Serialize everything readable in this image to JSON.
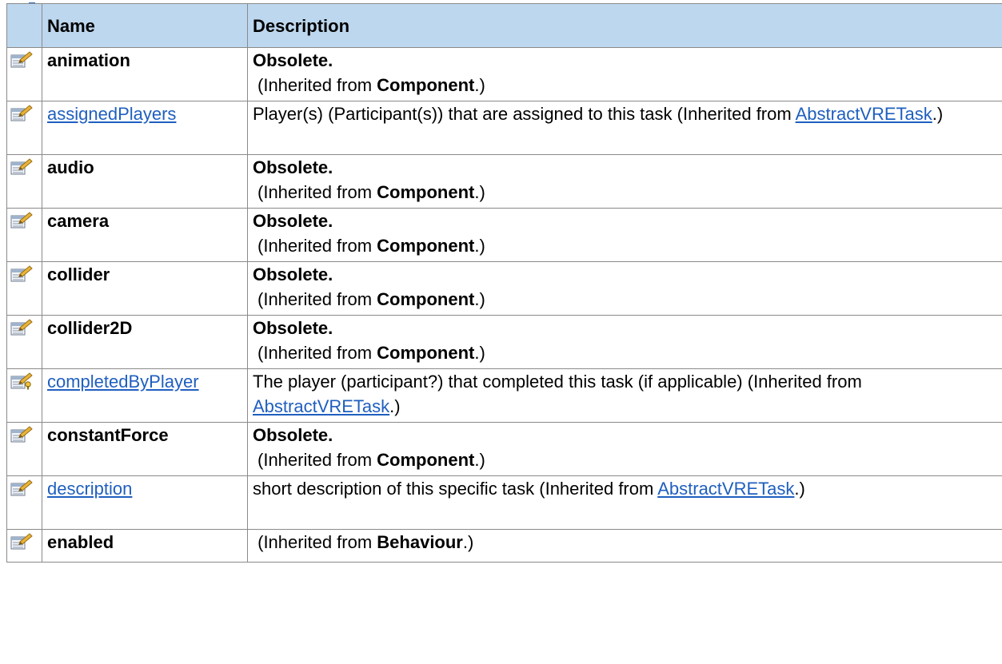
{
  "table": {
    "headers": {
      "name": "Name",
      "description": "Description"
    },
    "rows": [
      {
        "icon": "property-icon",
        "name": "animation",
        "name_type": "bold",
        "desc_main": "Obsolete.",
        "desc_prefix": "(Inherited from ",
        "desc_source": "Component",
        "desc_suffix": ".)"
      },
      {
        "icon": "property-icon",
        "name": "assignedPlayers",
        "name_type": "link",
        "desc_text": "Player(s) (Participant(s)) that are assigned to this task (Inherited from ",
        "desc_link": "AbstractVRETask",
        "desc_suffix": ".)"
      },
      {
        "icon": "property-icon",
        "name": "audio",
        "name_type": "bold",
        "desc_main": "Obsolete.",
        "desc_prefix": "(Inherited from ",
        "desc_source": "Component",
        "desc_suffix": ".)"
      },
      {
        "icon": "property-icon",
        "name": "camera",
        "name_type": "bold",
        "desc_main": "Obsolete.",
        "desc_prefix": "(Inherited from ",
        "desc_source": "Component",
        "desc_suffix": ".)"
      },
      {
        "icon": "property-icon",
        "name": "collider",
        "name_type": "bold",
        "desc_main": "Obsolete.",
        "desc_prefix": "(Inherited from ",
        "desc_source": "Component",
        "desc_suffix": ".)"
      },
      {
        "icon": "property-icon",
        "name": "collider2D",
        "name_type": "bold",
        "desc_main": "Obsolete.",
        "desc_prefix": "(Inherited from ",
        "desc_source": "Component",
        "desc_suffix": ".)"
      },
      {
        "icon": "property-key-icon",
        "name": "completedByPlayer",
        "name_type": "link",
        "desc_text": "The player (participant?) that completed this task (if applicable) (Inherited from ",
        "desc_link": "AbstractVRETask",
        "desc_suffix": ".)"
      },
      {
        "icon": "property-icon",
        "name": "constantForce",
        "name_type": "bold",
        "desc_main": "Obsolete.",
        "desc_prefix": "(Inherited from ",
        "desc_source": "Component",
        "desc_suffix": ".)"
      },
      {
        "icon": "property-icon",
        "name": "description",
        "name_type": "link",
        "desc_text": "short description of this specific task (Inherited from ",
        "desc_link": "AbstractVRETask",
        "desc_suffix": ".)"
      },
      {
        "icon": "property-icon",
        "name": "enabled",
        "name_type": "bold",
        "desc_prefix": " (Inherited from ",
        "desc_source": "Behaviour",
        "desc_suffix": ".)"
      }
    ]
  },
  "colors": {
    "header_bg": "#bdd7ee",
    "link": "#1f5fbf",
    "border": "#8a8a8a"
  }
}
